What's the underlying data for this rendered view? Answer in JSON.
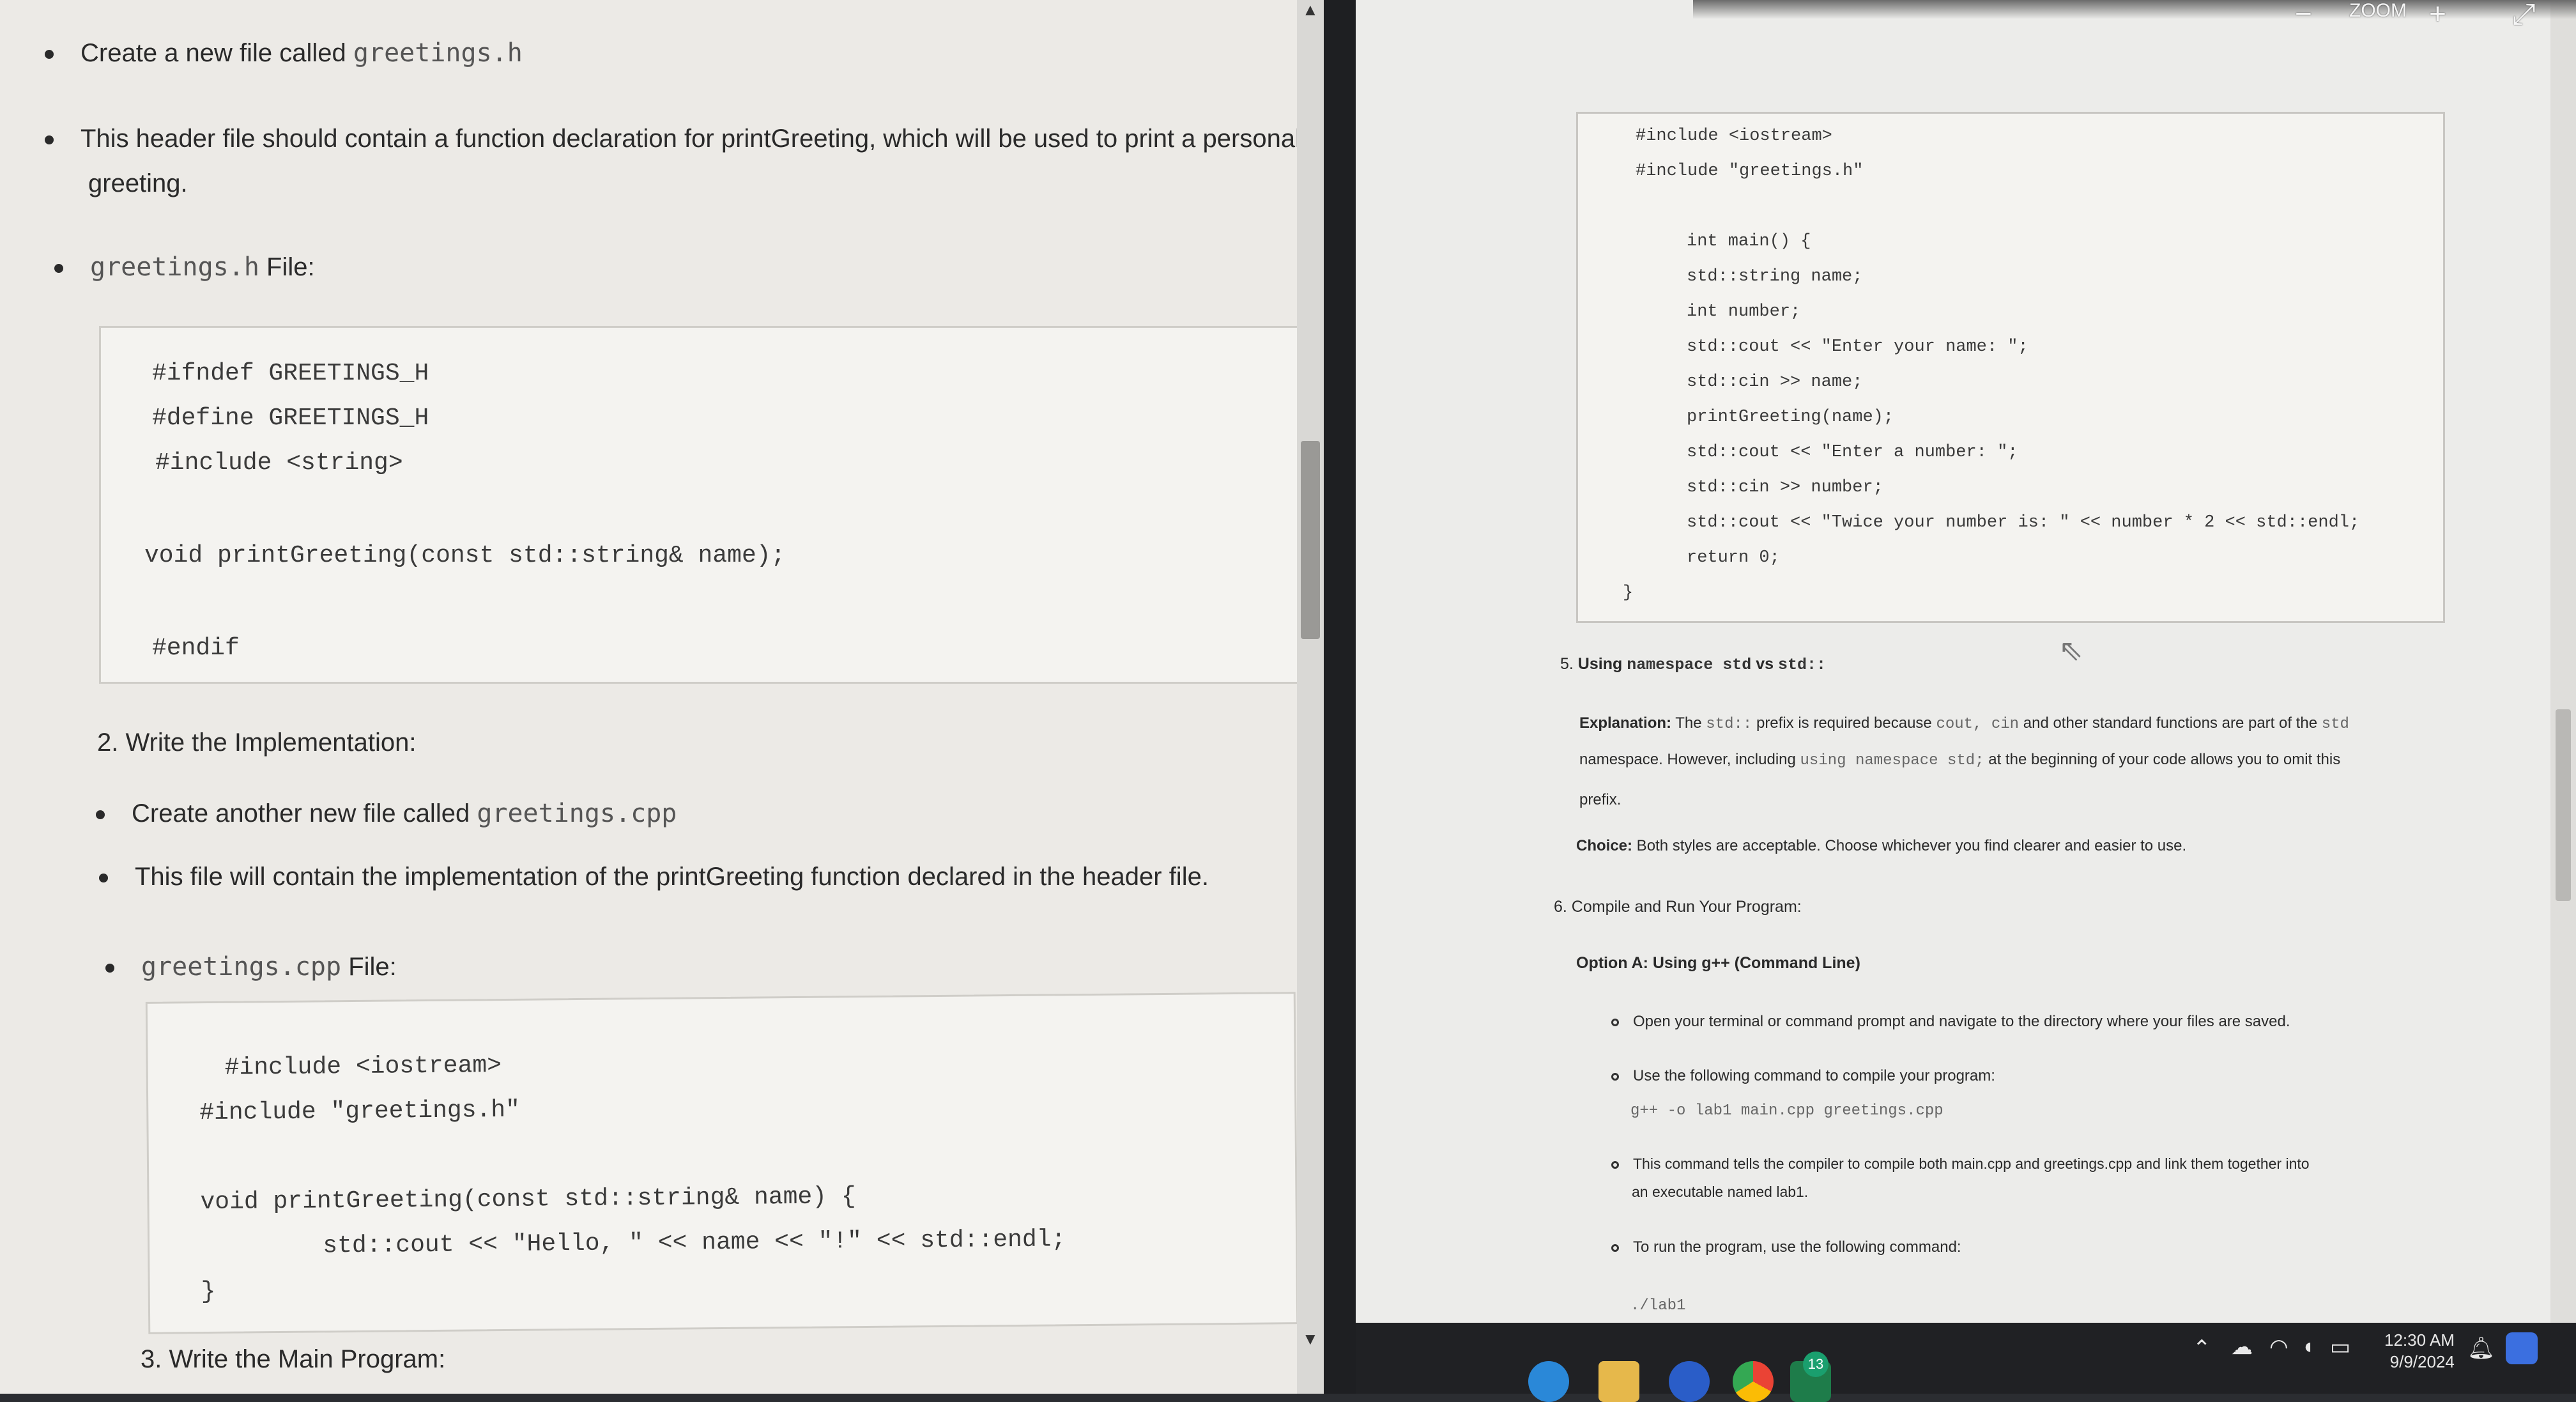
{
  "left_doc": {
    "bullet1_text": "Create a new file called ",
    "bullet1_code": "greetings.h",
    "bullet2_line1": "This header file should contain a function declaration for printGreeting, which will be used to print a personaliz",
    "bullet2_line2": "greeting.",
    "bullet3_code": "greetings.h",
    "bullet3_text": " File:",
    "header_code": [
      "#ifndef GREETINGS_H",
      "#define GREETINGS_H",
      "#include <string>",
      "void printGreeting(const std::string& name);",
      "#endif"
    ],
    "step2_title": "2. Write the Implementation:",
    "bullet4_text": "Create another new file called ",
    "bullet4_code": "greetings.cpp",
    "bullet5_text": "This file will contain the implementation of the printGreeting function declared in the header file.",
    "bullet6_code": "greetings.cpp",
    "bullet6_text": " File:",
    "impl_code": [
      "#include <iostream>",
      "#include \"greetings.h\"",
      "void printGreeting(const std::string& name) {",
      "    std::cout << \"Hello, \" << name << \"!\" << std::endl;",
      "}"
    ],
    "step3_title": "3. Write the Main Program:"
  },
  "right_doc": {
    "main_code": [
      "#include <iostream>",
      "#include \"greetings.h\"",
      "int main() {",
      "std::string name;",
      "int number;",
      "std::cout << \"Enter your name: \";",
      "std::cin >> name;",
      "printGreeting(name);",
      "std::cout << \"Enter a number: \";",
      "std::cin >> number;",
      "std::cout << \"Twice your number is: \" << number * 2 << std::endl;",
      "return 0;",
      "}"
    ],
    "step5_prefix": "5. ",
    "step5_title_a": "Using ",
    "step5_code": "namespace std",
    "step5_title_b": " vs ",
    "step5_code2": "std::",
    "explanation_label": "Explanation:",
    "explanation_l1_a": " The ",
    "explanation_l1_code": "std::",
    "explanation_l1_b": " prefix is required because ",
    "explanation_l1_code2": "cout, cin",
    "explanation_l1_c": " and other standard functions are part of the ",
    "explanation_l1_code3": "std",
    "explanation_l2_a": "namespace. However, including ",
    "explanation_l2_code": "using namespace std;",
    "explanation_l2_b": " at the beginning of your code allows you to omit this",
    "explanation_l3": "prefix.",
    "choice_label": "Choice:",
    "choice_text": " Both styles are acceptable. Choose whichever you find clearer and easier to use.",
    "step6_title": "6. Compile and Run Your Program:",
    "optionA_title": "Option A: Using g++ (Command Line)",
    "sub1": "Open your terminal or command prompt and navigate to the directory where your files are saved.",
    "sub2": "Use the following command to compile your program:",
    "compile_cmd": "g++ -o lab1 main.cpp greetings.cpp",
    "sub3_l1": "This command tells the compiler to compile both main.cpp and greetings.cpp and link them together into",
    "sub3_l2": "an executable named lab1.",
    "sub4": "To run the program, use the following command:",
    "run_cmd": "./lab1"
  },
  "zoom": {
    "label": "ZOOM",
    "minus": "−",
    "plus": "+"
  },
  "taskbar": {
    "time": "12:30 AM",
    "date": "9/9/2024",
    "badge_count": "13"
  }
}
